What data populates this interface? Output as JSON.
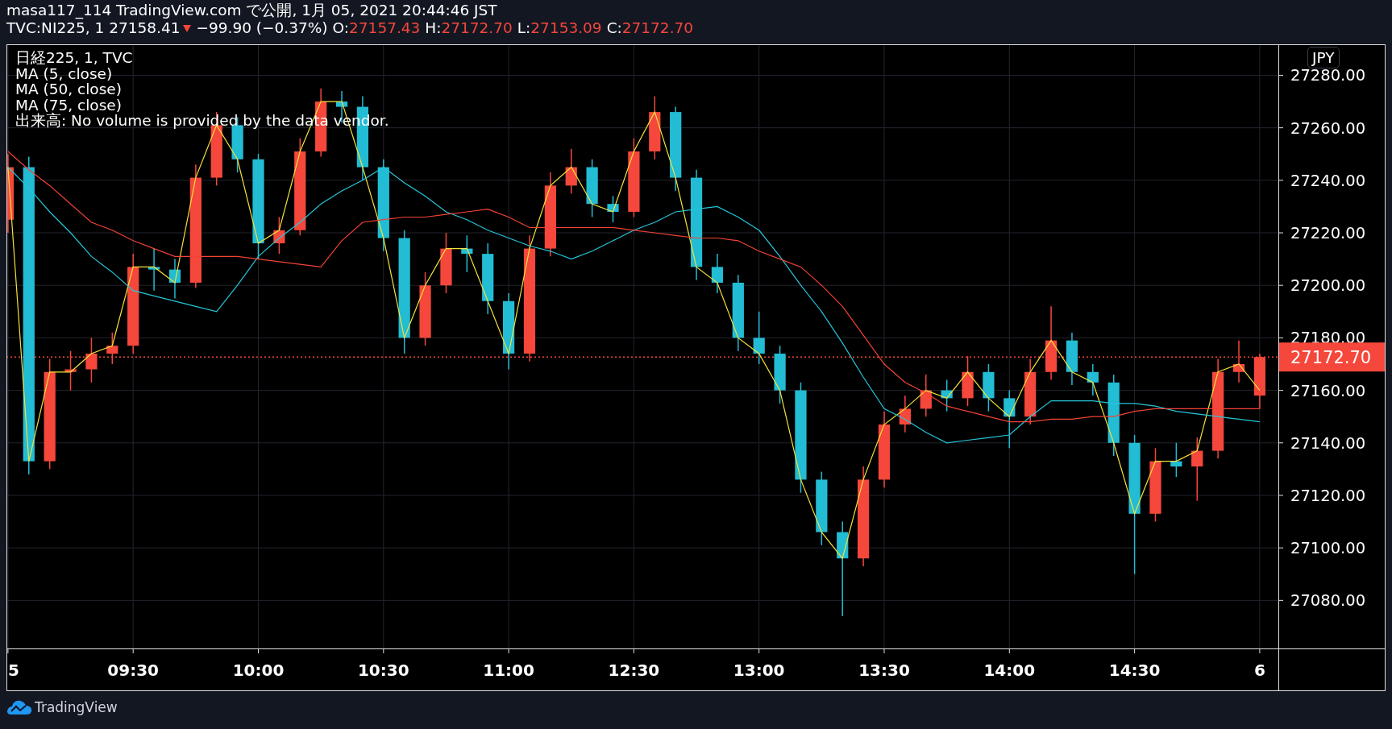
{
  "header": {
    "publisher": "masa117_114 TradingView.com で公開, 1月 05, 2021 20:44:46 JST",
    "symbol": "TVC:NI225, 1",
    "price": "27158.41",
    "falling": true,
    "change": "−99.90 (−0.37%)",
    "ohlc": [
      {
        "label": "O:",
        "value": "27157.43"
      },
      {
        "label": "H:",
        "value": "27172.70"
      },
      {
        "label": "L:",
        "value": "27153.09"
      },
      {
        "label": "C:",
        "value": "27172.70"
      }
    ]
  },
  "legend": {
    "title": "日経225, 1, TVC",
    "volume_note": "出来高: No volume is provided by the data vendor."
  },
  "currency_button": "JPY",
  "chart": {
    "chart_data": {
      "type": "candlestick",
      "grid": true,
      "categories": [
        "5",
        null,
        null,
        null,
        null,
        null,
        "09:30",
        null,
        null,
        null,
        null,
        null,
        "10:00",
        null,
        null,
        null,
        null,
        null,
        "10:30",
        null,
        null,
        null,
        null,
        null,
        "11:00",
        null,
        null,
        null,
        null,
        null,
        "12:30",
        null,
        null,
        null,
        null,
        null,
        "13:00",
        null,
        null,
        null,
        null,
        null,
        "13:30",
        null,
        null,
        null,
        null,
        null,
        "14:00",
        null,
        null,
        null,
        null,
        null,
        "14:30",
        null,
        null,
        null,
        null,
        null,
        "6"
      ],
      "ohlc": [
        [
          27225,
          27250,
          27220,
          27245
        ],
        [
          27245,
          27249,
          27128,
          27133
        ],
        [
          27133,
          27172,
          27130,
          27167
        ],
        [
          27167,
          27175,
          27160,
          27168
        ],
        [
          27168,
          27180,
          27163,
          27174
        ],
        [
          27174,
          27182,
          27170,
          27177
        ],
        [
          27177,
          27212,
          27174,
          27207
        ],
        [
          27207,
          27214,
          27198,
          27206
        ],
        [
          27206,
          27210,
          27195,
          27201
        ],
        [
          27201,
          27246,
          27199,
          27241
        ],
        [
          27241,
          27266,
          27238,
          27261
        ],
        [
          27261,
          27264,
          27243,
          27248
        ],
        [
          27248,
          27250,
          27210,
          27216
        ],
        [
          27216,
          27226,
          27212,
          27221
        ],
        [
          27221,
          27256,
          27219,
          27251
        ],
        [
          27251,
          27275,
          27249,
          27270
        ],
        [
          27270,
          27274,
          27262,
          27268
        ],
        [
          27268,
          27272,
          27240,
          27245
        ],
        [
          27245,
          27248,
          27213,
          27218
        ],
        [
          27218,
          27221,
          27174,
          27180
        ],
        [
          27180,
          27205,
          27177,
          27200
        ],
        [
          27200,
          27220,
          27197,
          27214
        ],
        [
          27214,
          27219,
          27205,
          27212
        ],
        [
          27212,
          27216,
          27189,
          27194
        ],
        [
          27194,
          27197,
          27168,
          27174
        ],
        [
          27174,
          27219,
          27171,
          27214
        ],
        [
          27214,
          27243,
          27211,
          27238
        ],
        [
          27238,
          27252,
          27235,
          27245
        ],
        [
          27245,
          27248,
          27226,
          27231
        ],
        [
          27231,
          27234,
          27224,
          27228
        ],
        [
          27228,
          27256,
          27226,
          27251
        ],
        [
          27251,
          27272,
          27248,
          27266
        ],
        [
          27266,
          27268,
          27236,
          27241
        ],
        [
          27241,
          27244,
          27202,
          27207
        ],
        [
          27207,
          27212,
          27197,
          27201
        ],
        [
          27201,
          27204,
          27175,
          27180
        ],
        [
          27180,
          27190,
          27170,
          27174
        ],
        [
          27174,
          27177,
          27155,
          27160
        ],
        [
          27160,
          27163,
          27121,
          27126
        ],
        [
          27126,
          27129,
          27101,
          27106
        ],
        [
          27106,
          27110,
          27074,
          27096
        ],
        [
          27096,
          27131,
          27093,
          27126
        ],
        [
          27126,
          27152,
          27123,
          27147
        ],
        [
          27147,
          27158,
          27144,
          27153
        ],
        [
          27153,
          27166,
          27150,
          27160
        ],
        [
          27160,
          27164,
          27152,
          27157
        ],
        [
          27157,
          27173,
          27154,
          27167
        ],
        [
          27167,
          27170,
          27152,
          27157
        ],
        [
          27157,
          27160,
          27138,
          27150
        ],
        [
          27150,
          27172,
          27147,
          27167
        ],
        [
          27167,
          27192,
          27164,
          27179
        ],
        [
          27179,
          27182,
          27162,
          27167
        ],
        [
          27167,
          27170,
          27158,
          27163
        ],
        [
          27163,
          27166,
          27135,
          27140
        ],
        [
          27140,
          27143,
          27090,
          27113
        ],
        [
          27113,
          27138,
          27110,
          27133
        ],
        [
          27133,
          27140,
          27127,
          27131
        ],
        [
          27131,
          27142,
          27118,
          27137
        ],
        [
          27137,
          27172,
          27134,
          27167
        ],
        [
          27167,
          27179,
          27163,
          27170
        ],
        [
          27158,
          27174,
          27153,
          27172.7
        ]
      ],
      "ylim": [
        27061.7,
        27291.8
      ],
      "series": [
        {
          "name": "MA (5, close)",
          "type": "line",
          "color": "#f5e23a",
          "values": [
            27245,
            27133,
            27167,
            27167,
            27174,
            27177,
            27207,
            27207,
            27201,
            27241,
            27261,
            27248,
            27216,
            27221,
            27251,
            27270,
            27270,
            27245,
            27218,
            27180,
            27200,
            27214,
            27214,
            27194,
            27174,
            27214,
            27238,
            27245,
            27231,
            27228,
            27251,
            27266,
            27241,
            27207,
            27201,
            27180,
            27174,
            27160,
            27126,
            27106,
            27096,
            27126,
            27147,
            27153,
            27160,
            27157,
            27167,
            27157,
            27150,
            27167,
            27179,
            27167,
            27163,
            27140,
            27113,
            27133,
            27133,
            27137,
            27167,
            27170,
            27160
          ]
        },
        {
          "name": "MA (50, close)",
          "type": "line",
          "color": "#26c6da",
          "values": [
            27245,
            27237,
            27228,
            27220,
            27211,
            27205,
            27198,
            27196,
            27194,
            27192,
            27190,
            27200,
            27211,
            27218,
            27224,
            27231,
            27236,
            27240,
            27245,
            27239,
            27234,
            27228,
            27225,
            27221,
            27218,
            27215,
            27213,
            27210,
            27213,
            27217,
            27221,
            27224,
            27228,
            27229,
            27230,
            27226,
            27221,
            27211,
            27200,
            27190,
            27178,
            27165,
            27153,
            27149,
            27144,
            27140,
            27141,
            27142,
            27143,
            27150,
            27156,
            27156,
            27156,
            27155,
            27155,
            27154,
            27152,
            27151,
            27150,
            27149,
            27148
          ]
        },
        {
          "name": "MA (75, close)",
          "type": "line",
          "color": "#f44336",
          "values": [
            27251,
            27244,
            27238,
            27231,
            27224,
            27221,
            27217,
            27214,
            27211,
            27211,
            27211,
            27211,
            27210,
            27209,
            27208,
            27207,
            27217,
            27224,
            27225,
            27226,
            27226,
            27227,
            27228,
            27229,
            27226,
            27222,
            27222,
            27222,
            27222,
            27222,
            27221,
            27220,
            27219,
            27218,
            27218,
            27217,
            27213,
            27210,
            27207,
            27200,
            27192,
            27181,
            27170,
            27163,
            27159,
            27154,
            27152,
            27150,
            27148,
            27148,
            27149,
            27149,
            27150,
            27150,
            27152,
            27153,
            27153,
            27153,
            27153,
            27153,
            27153
          ]
        }
      ],
      "ref_lines": [
        {
          "axis": "y",
          "value": 27172.7,
          "label": "27172.70",
          "color": "#f5473b"
        }
      ],
      "yticks": [
        {
          "value": 27080,
          "label": "27080.00"
        },
        {
          "value": 27100,
          "label": "27100.00"
        },
        {
          "value": 27120,
          "label": "27120.00"
        },
        {
          "value": 27140,
          "label": "27140.00"
        },
        {
          "value": 27160,
          "label": "27160.00"
        },
        {
          "value": 27180,
          "label": "27180.00"
        },
        {
          "value": 27200,
          "label": "27200.00"
        },
        {
          "value": 27220,
          "label": "27220.00"
        },
        {
          "value": 27240,
          "label": "27240.00"
        },
        {
          "value": 27260,
          "label": "27260.00"
        },
        {
          "value": 27280,
          "label": "27280.00"
        }
      ]
    }
  },
  "footer": {
    "brand": "TradingView"
  }
}
